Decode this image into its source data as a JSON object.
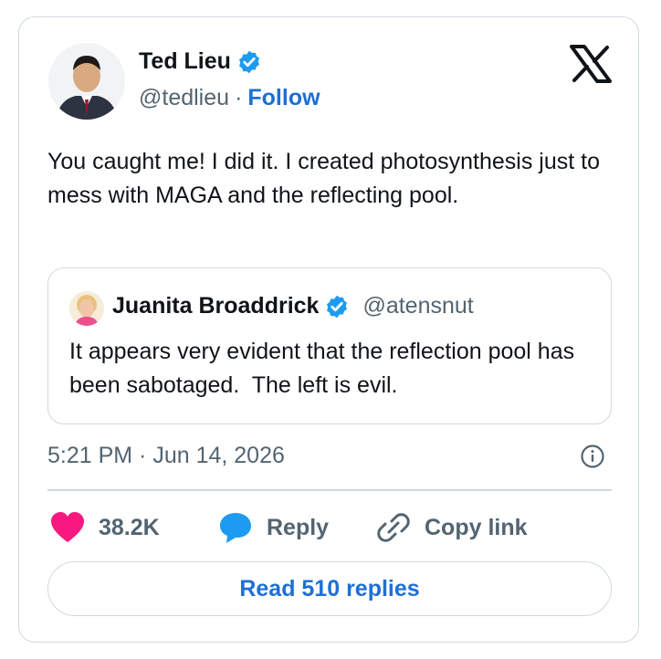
{
  "author": {
    "name": "Ted Lieu",
    "handle": "@tedlieu",
    "separator": "·",
    "follow_label": "Follow"
  },
  "tweet": {
    "text": "You caught me! I did it. I created photosynthesis just to mess with MAGA and the reflecting pool."
  },
  "quote": {
    "name": "Juanita Broaddrick",
    "handle": "@atensnut",
    "text": "It appears very evident that the reflection pool has been sabotaged.  The left is evil."
  },
  "timestamp": "5:21 PM · Jun 14, 2026",
  "actions": {
    "like_count": "38.2K",
    "reply_label": "Reply",
    "copy_link_label": "Copy link"
  },
  "read_replies_label": "Read 510 replies",
  "colors": {
    "verified": "#1d9bf0",
    "link": "#1d6fd6",
    "like": "#f91880",
    "muted": "#536471",
    "border": "#cfd9de"
  },
  "icons": [
    "x-logo-icon",
    "verified-badge-icon",
    "info-icon",
    "heart-icon",
    "reply-bubble-icon",
    "link-icon"
  ]
}
